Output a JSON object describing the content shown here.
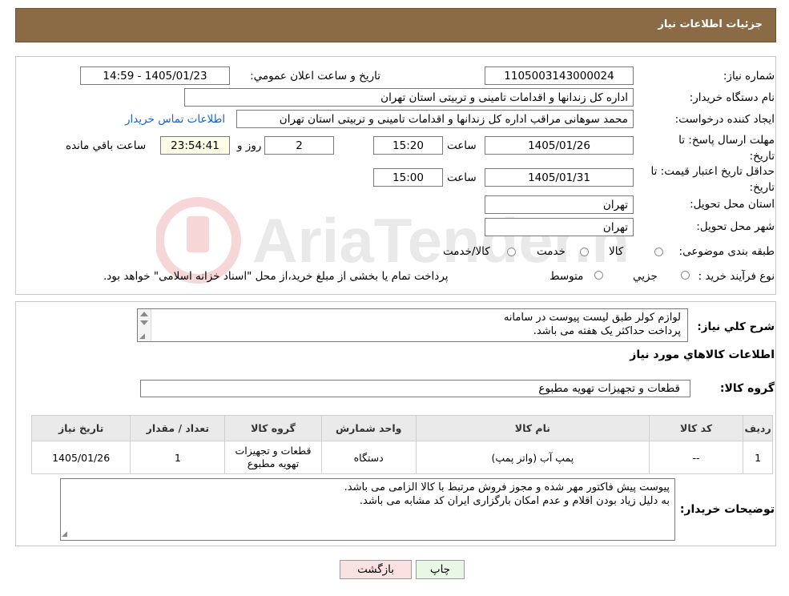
{
  "header": {
    "title": "جزئیات اطلاعات نیاز"
  },
  "form": {
    "need_number_label": "شماره نیاز:",
    "need_number": "1105003143000024",
    "announce_label": "تاریخ و ساعت اعلان عمومي:",
    "announce_value": "1405/01/23 - 14:59",
    "buyer_org_label": "نام دستگاه خريدار:",
    "buyer_org": "اداره کل زندانها و اقدامات تامینی و تربیتی استان تهران",
    "creator_label": "ايجاد کننده درخواست:",
    "creator": "محمد سوهانی مراقب  اداره کل زندانها و اقدامات تامینی و تربیتی استان تهران",
    "contact_link": "اطلاعات تماس خريدار",
    "reply_deadline_label": "مهلت ارسال پاسخ: تا تاريخ:",
    "reply_date": "1405/01/26",
    "time_label": "ساعت",
    "reply_time": "15:20",
    "days_value": "2",
    "days_label": "روز و",
    "remaining_time": "23:54:41",
    "remaining_label": "ساعت باقي مانده",
    "price_validity_label": "حداقل تاريخ اعتبار قيمت: تا تاريخ:",
    "price_date": "1405/01/31",
    "price_time": "15:00",
    "province_label": "استان محل تحويل:",
    "province": "تهران",
    "city_label": "شهر محل تحويل:",
    "city": "تهران",
    "category_label": "طبقه بندی موضوعی:",
    "category_options": [
      "کالا",
      "خدمت",
      "کالا/خدمت"
    ],
    "purchase_type_label": "نوع فرآيند خريد :",
    "purchase_options": [
      "جزيي",
      "متوسط"
    ],
    "purchase_note": "پرداخت تمام يا بخشی از مبلغ خريد،از محل \"اسناد خزانه اسلامی\" خواهد بود."
  },
  "summary": {
    "label": "شرح کلي نياز:",
    "line1": "لوازم کولر طبق لیست پیوست در سامانه",
    "line2": "پرداخت حداکثر یک هفته می باشد."
  },
  "goods": {
    "section_title": "اطلاعات کالاهاي مورد نياز",
    "group_label": "گروه کالا:",
    "group_value": "قطعات و تجهیزات تهویه مطبوع",
    "columns": [
      "رديف",
      "کد کالا",
      "نام کالا",
      "واحد شمارش",
      "گروه کالا",
      "تعداد / مقدار",
      "تاريخ نياز"
    ],
    "rows": [
      [
        "1",
        "--",
        "پمپ آب (واتر پمپ)",
        "دستگاه",
        "قطعات و تجهیزات تهویه مطبوع",
        "1",
        "1405/01/26"
      ]
    ]
  },
  "buyer_notes": {
    "label": "توضيحات خريدار:",
    "line1": "پیوست پیش فاکتور مهر شده و مجوز فروش مرتبط با کالا الزامی می باشد.",
    "line2": "به دلیل زیاد بودن اقلام و عدم امکان بارگزاری ایران کد مشابه می باشد."
  },
  "buttons": {
    "print": "چاپ",
    "back": "بازگشت"
  },
  "watermark": {
    "text": "AriaTender.neT"
  },
  "colors": {
    "header_bg": "#8b6b45",
    "link": "#1a62c8",
    "print_btn": "#e9f8e6",
    "back_btn": "#fbe2e2"
  }
}
